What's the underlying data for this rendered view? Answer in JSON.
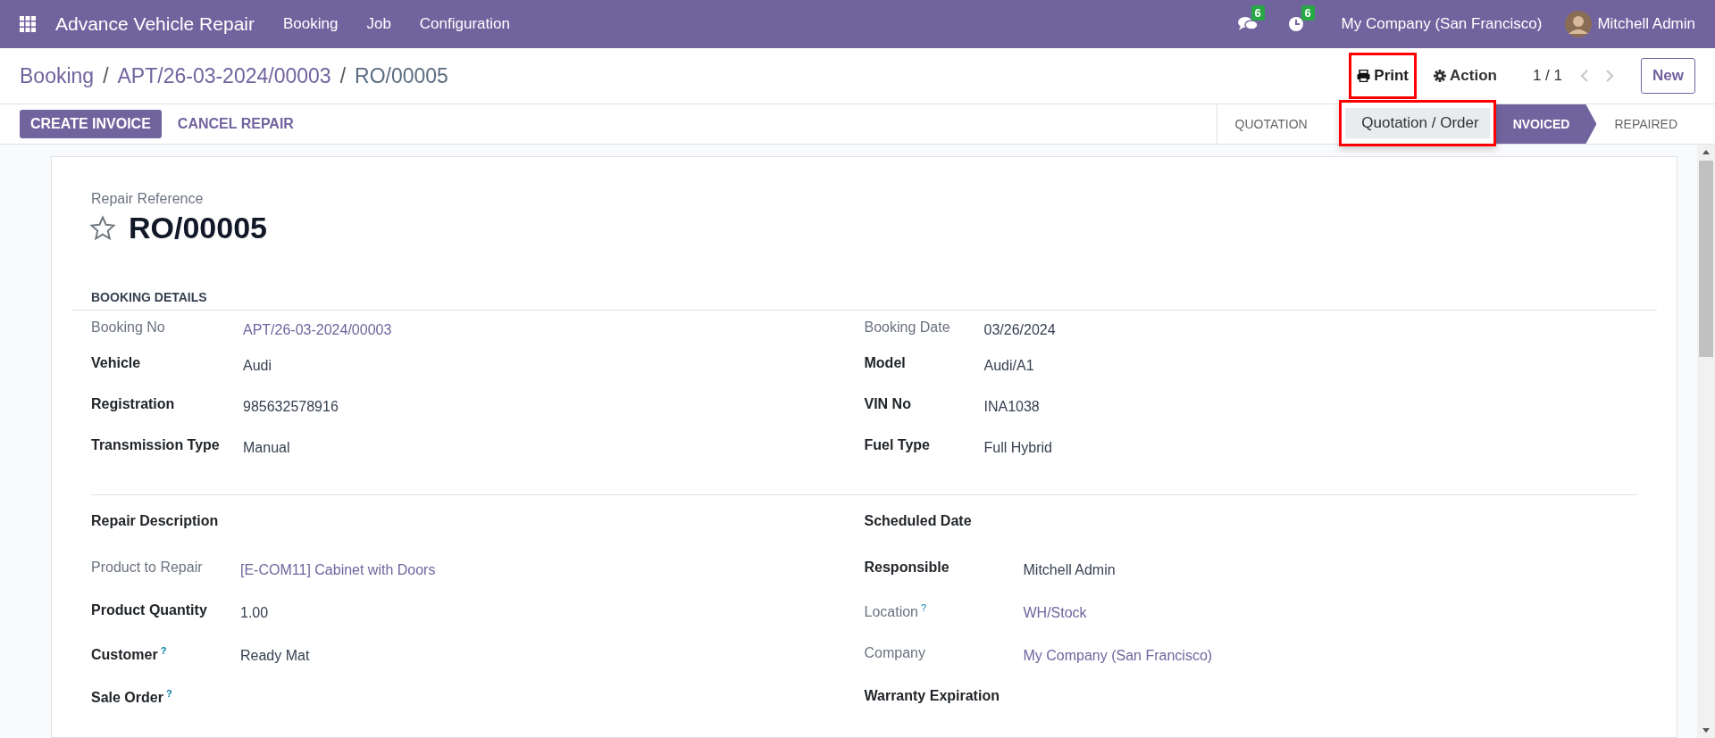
{
  "navbar": {
    "app_name": "Advance Vehicle Repair",
    "menu": [
      "Booking",
      "Job",
      "Configuration"
    ],
    "messages_count": "6",
    "activities_count": "6",
    "company": "My Company (San Francisco)",
    "user": "Mitchell Admin"
  },
  "breadcrumb": {
    "separator": "/",
    "items": [
      "Booking",
      "APT/26-03-2024/00003",
      "RO/00005"
    ]
  },
  "toolbar": {
    "print": "Print",
    "action": "Action",
    "pager": "1 / 1",
    "new": "New"
  },
  "print_menu": {
    "items": [
      "Quotation / Order"
    ]
  },
  "buttons": [
    {
      "label": "CREATE INVOICE",
      "primary": true
    },
    {
      "label": "CANCEL REPAIR",
      "primary": false
    }
  ],
  "statuses": [
    {
      "label": "QUOTATION",
      "selected": false
    },
    {
      "label": "NVOICED",
      "selected": true
    },
    {
      "label": "REPAIRED",
      "selected": false
    }
  ],
  "form": {
    "title_label": "Repair Reference",
    "title": "RO/00005",
    "starred": false,
    "groups": [
      {
        "heading": "BOOKING DETAILS",
        "left": [
          {
            "label": "Booking No",
            "muted": true,
            "value": "APT/26-03-2024/00003",
            "kind": "link"
          },
          {
            "label": "Vehicle",
            "muted": false,
            "value": "Audi",
            "kind": "text"
          },
          {
            "label": "Registration",
            "muted": false,
            "value": "985632578916",
            "kind": "text"
          },
          {
            "label": "Transmission Type",
            "muted": false,
            "value": "Manual",
            "kind": "text"
          }
        ],
        "right": [
          {
            "label": "Booking Date",
            "muted": true,
            "value": "03/26/2024",
            "kind": "text"
          },
          {
            "label": "Model",
            "muted": false,
            "value": "Audi/A1",
            "kind": "text"
          },
          {
            "label": "VIN No",
            "muted": false,
            "value": "INA1038",
            "kind": "text"
          },
          {
            "label": "Fuel Type",
            "muted": false,
            "value": "Full Hybrid",
            "kind": "text"
          }
        ]
      },
      {
        "left": [
          {
            "label": "Repair Description",
            "muted": false
          },
          {
            "label": "Product to Repair",
            "muted": true,
            "value": "[E-COM11] Cabinet with Doors",
            "kind": "link"
          },
          {
            "label": "Product Quantity",
            "muted": false,
            "value": "1.00",
            "kind": "text"
          },
          {
            "label": "Customer",
            "muted": false,
            "help": "?",
            "value": "Ready Mat",
            "kind": "text"
          },
          {
            "label": "Sale Order",
            "muted": false,
            "help": "?"
          }
        ],
        "right": [
          {
            "label": "Scheduled Date",
            "muted": false
          },
          {
            "label": "Responsible",
            "muted": false,
            "value": "Mitchell Admin",
            "kind": "text"
          },
          {
            "label": "Location",
            "muted": true,
            "help": "?",
            "value": "WH/Stock",
            "kind": "link"
          },
          {
            "label": "Company",
            "muted": true,
            "value": "My Company (San Francisco)",
            "kind": "link"
          },
          {
            "label": "Warranty Expiration",
            "muted": false
          }
        ]
      }
    ]
  }
}
